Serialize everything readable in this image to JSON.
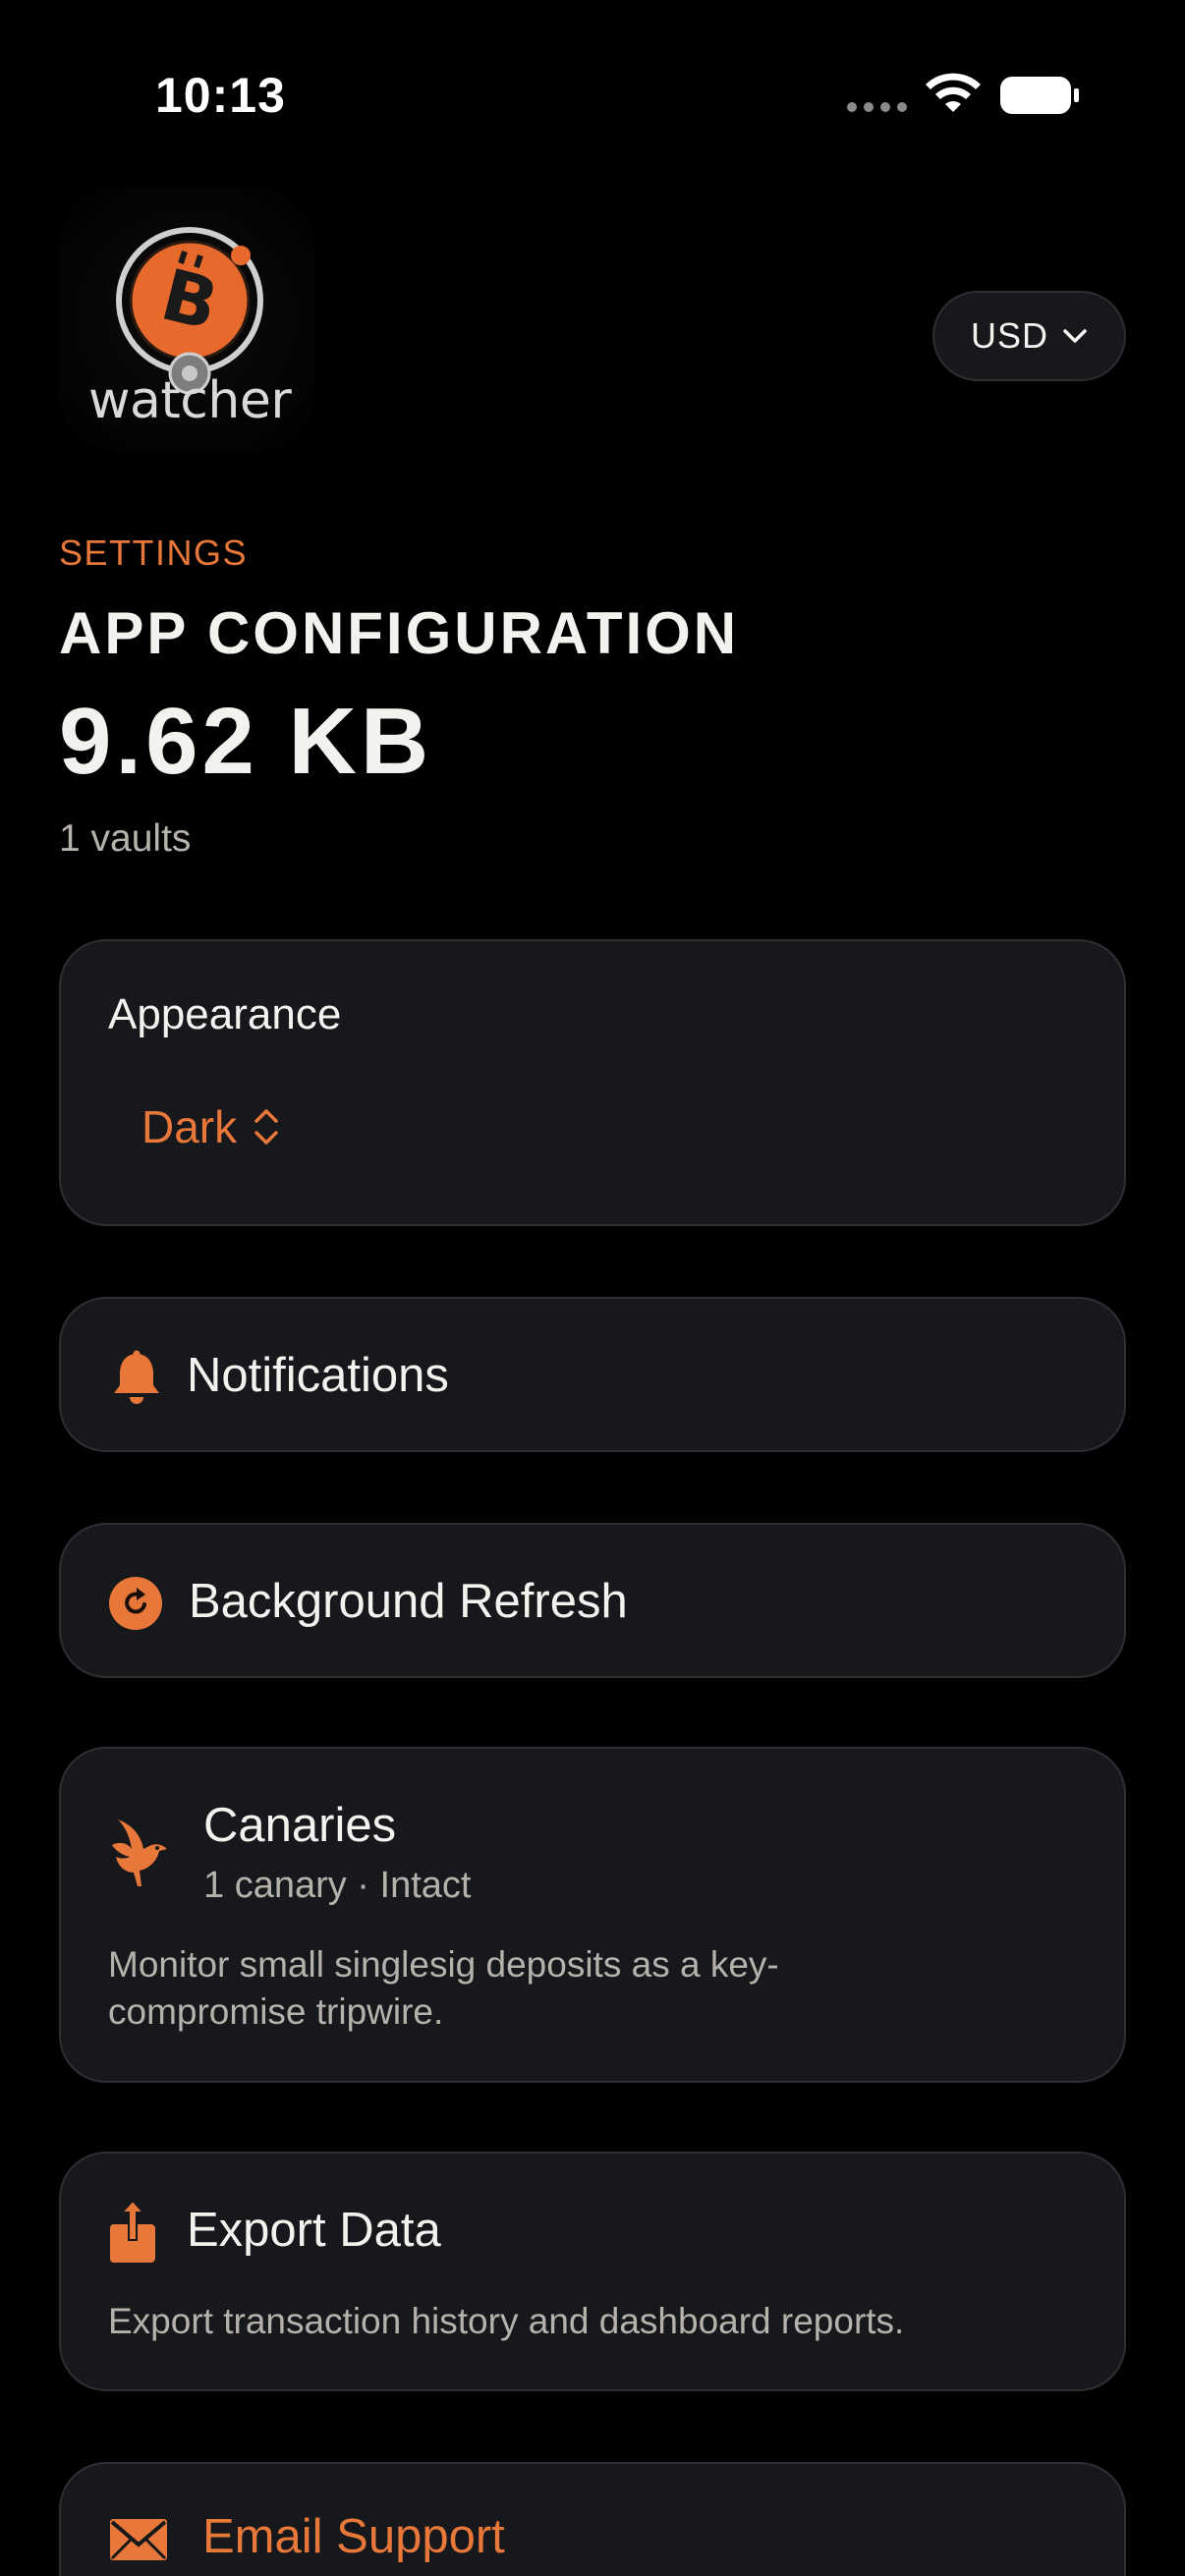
{
  "status_bar": {
    "time": "10:13",
    "icons": [
      "signal-dots-icon",
      "wifi-icon",
      "battery-icon"
    ]
  },
  "logo": {
    "text": "watcher",
    "emblem": "bitcoin-icon"
  },
  "currency": {
    "label": "USD",
    "icon": "chevron-down-icon"
  },
  "header": {
    "kicker": "SETTINGS",
    "title": "APP CONFIGURATION",
    "size": "9.62 KB",
    "vaults": "1 vaults"
  },
  "appearance": {
    "label": "Appearance",
    "value": "Dark",
    "icon": "updown-chevron-icon"
  },
  "notifications": {
    "label": "Notifications",
    "icon": "bell-icon"
  },
  "background_refresh": {
    "label": "Background Refresh",
    "icon": "refresh-icon"
  },
  "canaries": {
    "title": "Canaries",
    "status": "1 canary · Intact",
    "description": "Monitor small singlesig deposits as a key-compromise tripwire.",
    "icon": "bird-icon"
  },
  "export": {
    "label": "Export Data",
    "description": "Export transaction history and dashboard reports.",
    "icon": "share-icon"
  },
  "email_support": {
    "label": "Email Support",
    "icon": "mail-icon"
  },
  "colors": {
    "accent": "#e8773a",
    "background": "#000000",
    "card": "#17181b",
    "card_border": "#2e2f33",
    "text_primary": "#f4f2ee",
    "text_secondary": "#b5b2ac"
  }
}
